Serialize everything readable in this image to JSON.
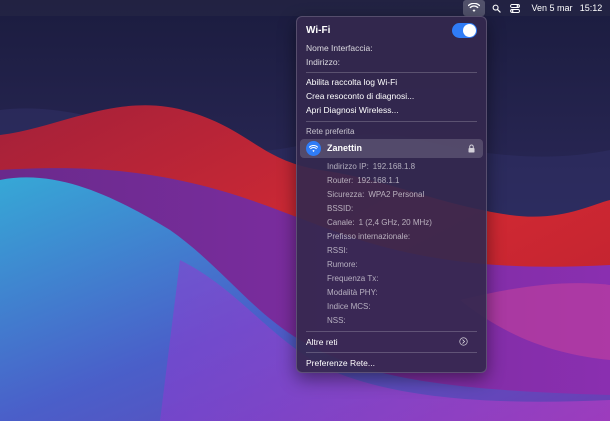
{
  "menubar": {
    "wifi_icon": "wifi-icon",
    "search_icon": "search-icon",
    "control_center_icon": "control-center-icon",
    "date": "Ven 5 mar",
    "time": "15:12"
  },
  "wifi_menu": {
    "title": "Wi-Fi",
    "toggle_on": true,
    "interface_name_label": "Nome Interfaccia:",
    "address_label": "Indirizzo:",
    "actions": [
      "Abilita raccolta log Wi-Fi",
      "Crea resoconto di diagnosi...",
      "Apri Diagnosi Wireless..."
    ],
    "preferred_header": "Rete preferita",
    "network": {
      "name": "Zanettin",
      "details": [
        {
          "label": "Indirizzo IP:",
          "value": "192.168.1.8"
        },
        {
          "label": "Router:",
          "value": "192.168.1.1"
        },
        {
          "label": "Sicurezza:",
          "value": "WPA2 Personal"
        },
        {
          "label": "BSSID:",
          "value": ""
        },
        {
          "label": "Canale:",
          "value": "1 (2,4 GHz, 20 MHz)"
        },
        {
          "label": "Prefisso internazionale:",
          "value": ""
        },
        {
          "label": "RSSI:",
          "value": ""
        },
        {
          "label": "Rumore:",
          "value": ""
        },
        {
          "label": "Frequenza Tx:",
          "value": ""
        },
        {
          "label": "Modalità PHY:",
          "value": ""
        },
        {
          "label": "Indice MCS:",
          "value": ""
        },
        {
          "label": "NSS:",
          "value": ""
        }
      ]
    },
    "other_networks": "Altre reti",
    "network_preferences": "Preferenze Rete..."
  },
  "colors": {
    "accent": "#2f7cf6",
    "menu_bg": "#34284e"
  }
}
